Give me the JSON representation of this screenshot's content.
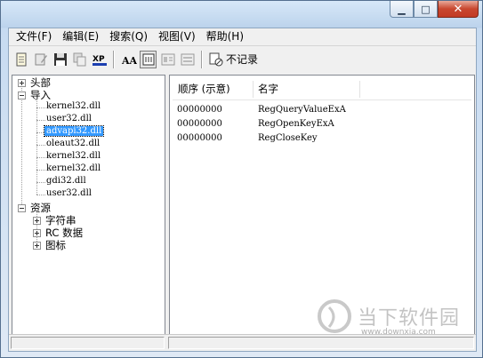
{
  "window": {
    "minimize_glyph": "▁",
    "maximize_glyph": "□",
    "close_glyph": "✕"
  },
  "menu": [
    "文件(F)",
    "编辑(E)",
    "搜索(Q)",
    "视图(V)",
    "帮助(H)"
  ],
  "toolbar": {
    "xp_label": "XP",
    "font_label": "AA",
    "norecord_label": "不记录"
  },
  "tree": {
    "header": "头部",
    "import": "导入",
    "dlls": [
      "kernel32.dll",
      "user32.dll",
      "advapi32.dll",
      "oleaut32.dll",
      "kernel32.dll",
      "kernel32.dll",
      "gdi32.dll",
      "user32.dll"
    ],
    "selected_index": 2,
    "resources": "资源",
    "resource_items": [
      "字符串",
      "RC 数据",
      "图标"
    ]
  },
  "list": {
    "columns": [
      "顺序 (示意)",
      "名字"
    ],
    "rows": [
      {
        "ordinal": "00000000",
        "name": "RegQueryValueExA"
      },
      {
        "ordinal": "00000000",
        "name": "RegOpenKeyExA"
      },
      {
        "ordinal": "00000000",
        "name": "RegCloseKey"
      }
    ]
  },
  "watermark": {
    "text": "当下软件园",
    "url": "www.downxia.com"
  },
  "colors": {
    "selection": "#3399ff",
    "close_button": "#c8472f"
  }
}
